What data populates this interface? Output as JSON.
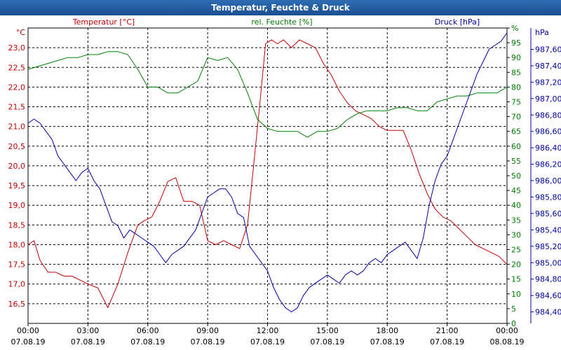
{
  "window": {
    "title": "Temperatur, Feuchte & Druck"
  },
  "colors": {
    "temperature": "#c00000",
    "humidity": "#008000",
    "pressure": "#0000a0",
    "grid": "#000000",
    "titlebar": "#1f5aa6"
  },
  "chart_data": {
    "type": "line",
    "title": "Temperatur, Feuchte & Druck",
    "grid": true,
    "legend": "top",
    "x_axis": {
      "range_hours": [
        0,
        24
      ],
      "ticks": [
        {
          "h": 0,
          "time": "00:00",
          "date": "07.08.19"
        },
        {
          "h": 3,
          "time": "03:00",
          "date": "07.08.19"
        },
        {
          "h": 6,
          "time": "06:00",
          "date": "07.08.19"
        },
        {
          "h": 9,
          "time": "09:00",
          "date": "07.08.19"
        },
        {
          "h": 12,
          "time": "12:00",
          "date": "07.08.19"
        },
        {
          "h": 15,
          "time": "15:00",
          "date": "07.08.19"
        },
        {
          "h": 18,
          "time": "18:00",
          "date": "07.08.19"
        },
        {
          "h": 21,
          "time": "21:00",
          "date": "07.08.19"
        },
        {
          "h": 24,
          "time": "00:00",
          "date": "08.08.19"
        }
      ]
    },
    "axes": {
      "temperature": {
        "unit": "°C",
        "ylim": [
          16.0,
          23.5
        ],
        "ticks": [
          "16,5",
          "17,0",
          "17,5",
          "18,0",
          "18,5",
          "19,0",
          "19,5",
          "20,0",
          "20,5",
          "21,0",
          "21,5",
          "22,0",
          "22,5",
          "23,0"
        ]
      },
      "humidity": {
        "unit": "%",
        "ylim": [
          0,
          100
        ],
        "ticks": [
          "0",
          "5",
          "10",
          "15",
          "20",
          "25",
          "30",
          "35",
          "40",
          "45",
          "50",
          "55",
          "60",
          "65",
          "70",
          "75",
          "80",
          "85",
          "90",
          "95",
          "%"
        ]
      },
      "pressure": {
        "unit": "hPa",
        "ylim": [
          984.26,
          987.86
        ],
        "ticks": [
          "984,40",
          "984,60",
          "984,80",
          "985,00",
          "985,20",
          "985,40",
          "985,60",
          "985,80",
          "986,00",
          "986,20",
          "986,40",
          "986,60",
          "986,80",
          "987,00",
          "987,20",
          "987,40",
          "987,60"
        ]
      }
    },
    "series": [
      {
        "name": "Temperatur [°C]",
        "axis": "temperature",
        "x": [
          0,
          0.3,
          0.6,
          1.0,
          1.4,
          1.8,
          2.2,
          2.6,
          3.0,
          3.5,
          4.0,
          4.5,
          5.0,
          5.5,
          5.8,
          6.2,
          6.6,
          7.0,
          7.4,
          7.8,
          8.2,
          8.6,
          9.0,
          9.4,
          9.8,
          10.2,
          10.6,
          11.0,
          11.3,
          11.6,
          11.9,
          12.2,
          12.5,
          12.8,
          13.2,
          13.6,
          14.0,
          14.4,
          14.8,
          15.2,
          15.6,
          16.0,
          16.4,
          16.8,
          17.2,
          17.6,
          18.0,
          18.4,
          18.8,
          19.2,
          19.6,
          20.0,
          20.4,
          20.8,
          21.2,
          21.6,
          22.0,
          22.4,
          22.8,
          23.2,
          23.6,
          24.0
        ],
        "y": [
          18.0,
          18.1,
          17.6,
          17.3,
          17.3,
          17.2,
          17.2,
          17.1,
          17.0,
          16.9,
          16.4,
          17.0,
          17.8,
          18.5,
          18.6,
          18.7,
          19.1,
          19.6,
          19.7,
          19.1,
          19.1,
          19.0,
          18.1,
          18.0,
          18.1,
          18.0,
          17.9,
          18.5,
          20.0,
          21.5,
          23.1,
          23.2,
          23.1,
          23.2,
          23.0,
          23.2,
          23.1,
          23.0,
          22.6,
          22.3,
          21.9,
          21.6,
          21.4,
          21.3,
          21.2,
          21.0,
          20.9,
          20.9,
          20.9,
          20.4,
          19.8,
          19.3,
          18.9,
          18.7,
          18.6,
          18.4,
          18.2,
          18.0,
          17.9,
          17.8,
          17.7,
          17.5
        ]
      },
      {
        "name": "rel. Feuchte [%]",
        "axis": "humidity",
        "x": [
          0,
          0.5,
          1.0,
          1.5,
          2.0,
          2.5,
          3.0,
          3.5,
          4.0,
          4.5,
          5.0,
          5.5,
          6.0,
          6.5,
          7.0,
          7.5,
          8.0,
          8.5,
          9.0,
          9.5,
          10.0,
          10.5,
          11.0,
          11.5,
          12.0,
          12.5,
          13.0,
          13.5,
          14.0,
          14.5,
          15.0,
          15.5,
          16.0,
          16.5,
          17.0,
          17.5,
          18.0,
          18.5,
          19.0,
          19.5,
          20.0,
          20.5,
          21.0,
          21.5,
          22.0,
          22.5,
          23.0,
          23.5,
          24.0
        ],
        "y": [
          86,
          87,
          88,
          89,
          90,
          90,
          91,
          91,
          92,
          92,
          91,
          86,
          80,
          80,
          78,
          78,
          80,
          82,
          90,
          89,
          90,
          86,
          78,
          69,
          66,
          65,
          65,
          65,
          63,
          65,
          65,
          66,
          69,
          71,
          72,
          72,
          72,
          73,
          73,
          72,
          72,
          75,
          76,
          77,
          77,
          78,
          78,
          78,
          80
        ]
      },
      {
        "name": "Druck [hPa]",
        "axis": "pressure",
        "x": [
          0,
          0.3,
          0.6,
          0.9,
          1.2,
          1.5,
          1.8,
          2.1,
          2.4,
          2.7,
          3.0,
          3.3,
          3.6,
          3.9,
          4.2,
          4.5,
          4.8,
          5.1,
          5.4,
          5.7,
          6.0,
          6.3,
          6.6,
          6.9,
          7.2,
          7.5,
          7.8,
          8.1,
          8.4,
          8.7,
          9.0,
          9.3,
          9.6,
          9.9,
          10.2,
          10.5,
          10.8,
          11.1,
          11.4,
          11.7,
          12.0,
          12.3,
          12.6,
          12.9,
          13.2,
          13.5,
          13.8,
          14.1,
          14.4,
          14.7,
          15.0,
          15.3,
          15.6,
          15.9,
          16.2,
          16.5,
          16.8,
          17.1,
          17.4,
          17.7,
          18.0,
          18.3,
          18.6,
          18.9,
          19.2,
          19.5,
          19.8,
          20.1,
          20.4,
          20.7,
          21.0,
          21.3,
          21.6,
          21.9,
          22.2,
          22.5,
          22.8,
          23.1,
          23.4,
          23.7,
          24.0
        ],
        "y": [
          986.7,
          986.75,
          986.7,
          986.6,
          986.5,
          986.3,
          986.2,
          986.1,
          986.0,
          986.1,
          986.15,
          986.0,
          985.9,
          985.7,
          985.5,
          985.45,
          985.3,
          985.4,
          985.35,
          985.3,
          985.25,
          985.2,
          985.1,
          985.0,
          985.1,
          985.15,
          985.2,
          985.3,
          985.4,
          985.6,
          985.8,
          985.85,
          985.9,
          985.9,
          985.8,
          985.6,
          985.55,
          985.2,
          985.1,
          985.0,
          984.9,
          984.7,
          984.55,
          984.45,
          984.4,
          984.45,
          984.6,
          984.7,
          984.75,
          984.8,
          984.85,
          984.8,
          984.75,
          984.85,
          984.9,
          984.85,
          984.9,
          985.0,
          985.05,
          985.0,
          985.1,
          985.15,
          985.2,
          985.25,
          985.15,
          985.05,
          985.3,
          985.7,
          986.0,
          986.2,
          986.3,
          986.5,
          986.7,
          986.9,
          987.1,
          987.3,
          987.45,
          987.6,
          987.65,
          987.7,
          987.8
        ]
      }
    ]
  }
}
